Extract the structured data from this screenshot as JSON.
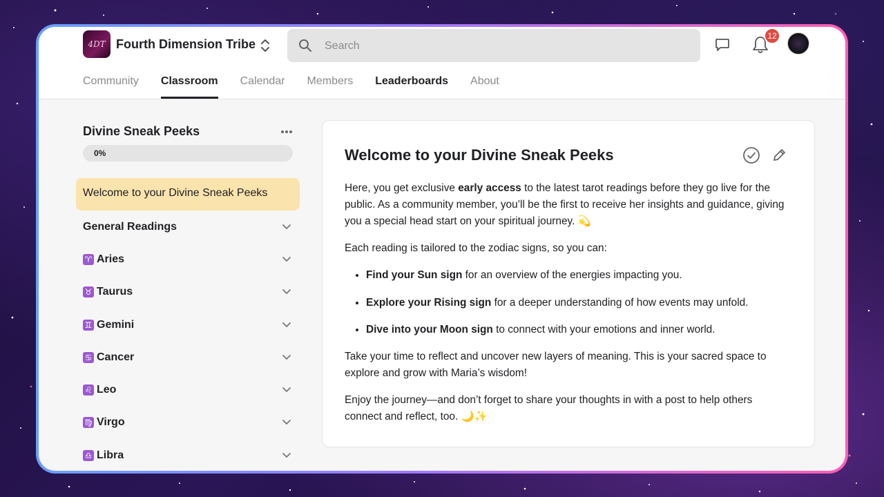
{
  "header": {
    "community_name": "Fourth Dimension Tribe",
    "logo_text": "4DT",
    "search_placeholder": "Search",
    "notification_count": "12"
  },
  "tabs": [
    {
      "label": "Community"
    },
    {
      "label": "Classroom"
    },
    {
      "label": "Calendar"
    },
    {
      "label": "Members"
    },
    {
      "label": "Leaderboards"
    },
    {
      "label": "About"
    }
  ],
  "active_tab": "Classroom",
  "sidebar": {
    "course_title": "Divine Sneak Peeks",
    "progress_label": "0%",
    "progress_value": 0,
    "active_lesson": "Welcome to your Divine Sneak Peeks",
    "sections": [
      {
        "symbol": "",
        "label": "General Readings"
      },
      {
        "symbol": "♈",
        "label": "Aries"
      },
      {
        "symbol": "♉",
        "label": "Taurus"
      },
      {
        "symbol": "♊",
        "label": "Gemini"
      },
      {
        "symbol": "♋",
        "label": "Cancer"
      },
      {
        "symbol": "♌",
        "label": "Leo"
      },
      {
        "symbol": "♍",
        "label": "Virgo"
      },
      {
        "symbol": "♎",
        "label": "Libra"
      }
    ]
  },
  "lesson": {
    "title": "Welcome to your Divine Sneak Peeks",
    "p1_before": "Here, you get exclusive ",
    "p1_bold": "early access",
    "p1_after": " to the latest tarot readings before they go live for the public. As a community member, you’ll be the first to receive her insights and guidance, giving you a special head start on your spiritual journey. 💫",
    "p2": "Each reading is tailored to the zodiac signs, so you can:",
    "bullets": [
      {
        "bold": "Find your Sun sign",
        "text": " for an overview of the energies impacting you."
      },
      {
        "bold": "Explore your Rising sign",
        "text": " for a deeper understanding of how events may unfold."
      },
      {
        "bold": "Dive into your Moon sign",
        "text": " to connect with your emotions and inner world."
      }
    ],
    "p3": "Take your time to reflect and uncover new layers of meaning. This is your sacred space to explore and grow with Maria’s wisdom!",
    "p4": "Enjoy the journey—and don’t forget to share your thoughts in with a post to help others connect and reflect, too. 🌙✨"
  },
  "colors": {
    "active_lesson_bg": "#fbe3ad",
    "badge": "#e04a3f",
    "zodiac_badge": "#9b59d0",
    "frame_gradient": [
      "#6aa0ff",
      "#9b7bff",
      "#ff5fb1"
    ]
  },
  "icons": [
    "switch-icon",
    "search-icon",
    "chat-icon",
    "bell-icon",
    "more-icon",
    "chevron-down-icon",
    "check-circle-icon",
    "pencil-icon"
  ]
}
